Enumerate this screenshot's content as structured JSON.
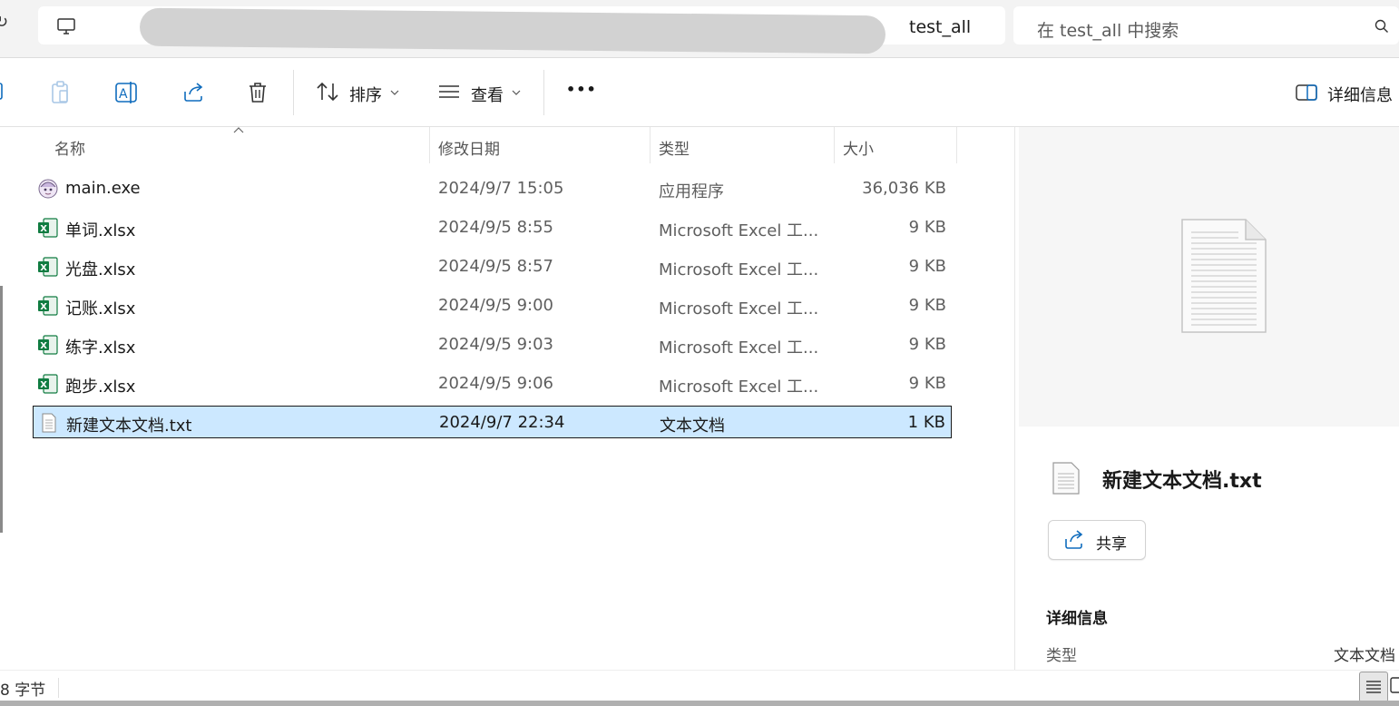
{
  "address": {
    "breadcrumb": "test_all",
    "search_placeholder": "在 test_all 中搜索"
  },
  "toolbar": {
    "sort_label": "排序",
    "view_label": "查看",
    "more_label": "•••",
    "details_label": "详细信息"
  },
  "columns": {
    "name": "名称",
    "date": "修改日期",
    "type": "类型",
    "size": "大小"
  },
  "files": [
    {
      "name": "main.exe",
      "date": "2024/9/7 15:05",
      "type": "应用程序",
      "size": "36,036 KB",
      "icon": "exe-app-icon",
      "selected": false
    },
    {
      "name": "单词.xlsx",
      "date": "2024/9/5 8:55",
      "type": "Microsoft Excel 工...",
      "size": "9 KB",
      "icon": "excel-icon",
      "selected": false
    },
    {
      "name": "光盘.xlsx",
      "date": "2024/9/5 8:57",
      "type": "Microsoft Excel 工...",
      "size": "9 KB",
      "icon": "excel-icon",
      "selected": false
    },
    {
      "name": "记账.xlsx",
      "date": "2024/9/5 9:00",
      "type": "Microsoft Excel 工...",
      "size": "9 KB",
      "icon": "excel-icon",
      "selected": false
    },
    {
      "name": "练字.xlsx",
      "date": "2024/9/5 9:03",
      "type": "Microsoft Excel 工...",
      "size": "9 KB",
      "icon": "excel-icon",
      "selected": false
    },
    {
      "name": "跑步.xlsx",
      "date": "2024/9/5 9:06",
      "type": "Microsoft Excel 工...",
      "size": "9 KB",
      "icon": "excel-icon",
      "selected": false
    },
    {
      "name": "新建文本文档.txt",
      "date": "2024/9/7 22:34",
      "type": "文本文档",
      "size": "1 KB",
      "icon": "text-file-icon",
      "selected": true
    }
  ],
  "details_pane": {
    "title": "新建文本文档.txt",
    "share_label": "共享",
    "section_title": "详细信息",
    "type_key": "类型",
    "type_value": "文本文档"
  },
  "status": {
    "text": "8 字节"
  },
  "colors": {
    "selection_bg": "#cce8ff",
    "excel_green": "#107c41",
    "accent_blue": "#0f6cbd"
  }
}
